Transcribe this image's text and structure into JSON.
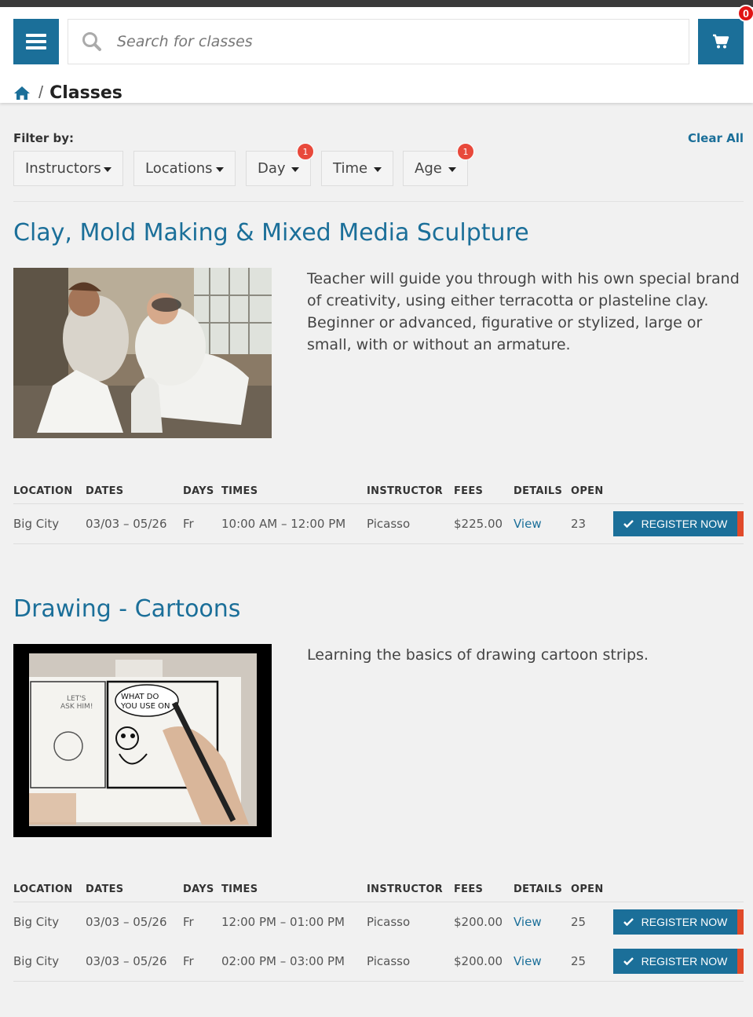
{
  "header": {
    "search_placeholder": "Search for classes",
    "cart_count": "0",
    "breadcrumb_sep": "/",
    "breadcrumb_current": "Classes"
  },
  "filters": {
    "label": "Filter by:",
    "clear_all": "Clear All",
    "items": [
      {
        "label": "Instructors",
        "badge": ""
      },
      {
        "label": "Locations",
        "badge": ""
      },
      {
        "label": "Day",
        "badge": "1"
      },
      {
        "label": "Time",
        "badge": "1"
      },
      {
        "label": "Age",
        "badge": "1"
      }
    ]
  },
  "table_headers": [
    "LOCATION",
    "DATES",
    "DAYS",
    "TIMES",
    "INSTRUCTOR",
    "FEES",
    "DETAILS",
    "OPEN"
  ],
  "register_label": "REGISTER NOW",
  "classes": [
    {
      "title": "Clay, Mold Making & Mixed Media Sculpture",
      "description": "Teacher will guide you through with his own special brand of creativity, using either terracotta or plasteline clay. Beginner or advanced, figurative or stylized, large or small, with or without an armature.",
      "sessions": [
        {
          "location": "Big City",
          "dates": "03/03 – 05/26",
          "days": "Fr",
          "times": "10:00 AM – 12:00 PM",
          "instructor": "Picasso",
          "fees": "$225.00",
          "details": "View",
          "open": "23"
        }
      ]
    },
    {
      "title": "Drawing - Cartoons",
      "description": "Learning the basics of drawing cartoon strips.",
      "sessions": [
        {
          "location": "Big City",
          "dates": "03/03 – 05/26",
          "days": "Fr",
          "times": "12:00 PM – 01:00 PM",
          "instructor": "Picasso",
          "fees": "$200.00",
          "details": "View",
          "open": "25"
        },
        {
          "location": "Big City",
          "dates": "03/03 – 05/26",
          "days": "Fr",
          "times": "02:00 PM – 03:00 PM",
          "instructor": "Picasso",
          "fees": "$200.00",
          "details": "View",
          "open": "25"
        }
      ]
    }
  ],
  "cartoon_art": {
    "bubble_line1": "WHAT DO",
    "bubble_line2": "YOU USE ON",
    "panel_text_line1": "LET'S",
    "panel_text_line2": "ASK HIM!"
  },
  "colors": {
    "accent": "#1b6f99",
    "badge_red": "#e8493b",
    "cart_badge": "#e01414"
  }
}
